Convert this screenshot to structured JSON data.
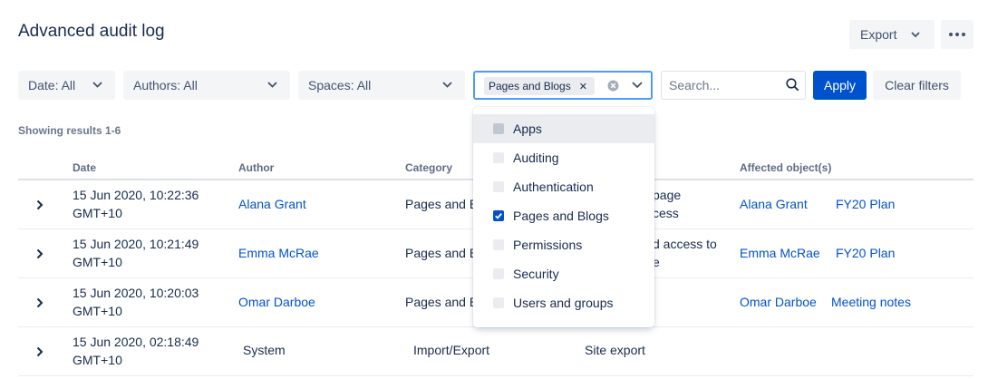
{
  "page": {
    "title": "Advanced audit log"
  },
  "toolbar": {
    "export_label": "Export"
  },
  "filters": {
    "date": "Date: All",
    "authors": "Authors: All",
    "spaces": "Spaces: All",
    "category_tag": "Pages and Blogs",
    "search_placeholder": "Search...",
    "apply": "Apply",
    "clear": "Clear filters"
  },
  "results_text": "Showing results 1-6",
  "table": {
    "headers": {
      "date": "Date",
      "author": "Author",
      "category": "Category",
      "affected": "Affected object(s)"
    },
    "rows": [
      {
        "date1": "15 Jun 2020, 10:22:36",
        "date2": "GMT+10",
        "author": "Alana Grant",
        "category": "Pages and B",
        "summary1": "page",
        "summary2": "cess",
        "aff1": "Alana Grant",
        "aff2": "FY20 Plan"
      },
      {
        "date1": "15 Jun 2020, 10:21:49",
        "date2": "GMT+10",
        "author": "Emma McRae",
        "category": "Pages and B",
        "summary1": "d access to",
        "summary2": "e",
        "aff1": "Emma McRae",
        "aff2": "FY20 Plan"
      },
      {
        "date1": "15 Jun 2020, 10:20:03",
        "date2": "GMT+10",
        "author": "Omar Darboe",
        "category": "Pages and B",
        "summary1": "",
        "summary2": "",
        "aff1": "Omar Darboe",
        "aff2": "Meeting notes"
      },
      {
        "date1": "15 Jun 2020, 02:18:49",
        "date2": "GMT+10",
        "author": "System",
        "category": "Import/Export",
        "summary1": "Site export",
        "summary2": "",
        "aff1": "",
        "aff2": ""
      }
    ]
  },
  "dropdown": {
    "options": [
      {
        "label": "Apps",
        "checked": false
      },
      {
        "label": "Auditing",
        "checked": false
      },
      {
        "label": "Authentication",
        "checked": false
      },
      {
        "label": "Pages and Blogs",
        "checked": true
      },
      {
        "label": "Permissions",
        "checked": false
      },
      {
        "label": "Security",
        "checked": false
      },
      {
        "label": "Users and groups",
        "checked": false
      }
    ]
  },
  "colors": {
    "primary": "#0052cc",
    "focus": "#4c9aff",
    "text": "#172b4d",
    "subtle": "#6b778c"
  },
  "icons": {
    "chevron": "chevron-down-icon",
    "expand": "chevron-right-icon",
    "search": "search-icon",
    "more": "more-icon",
    "clear": "clear-icon",
    "check": "check-icon"
  }
}
